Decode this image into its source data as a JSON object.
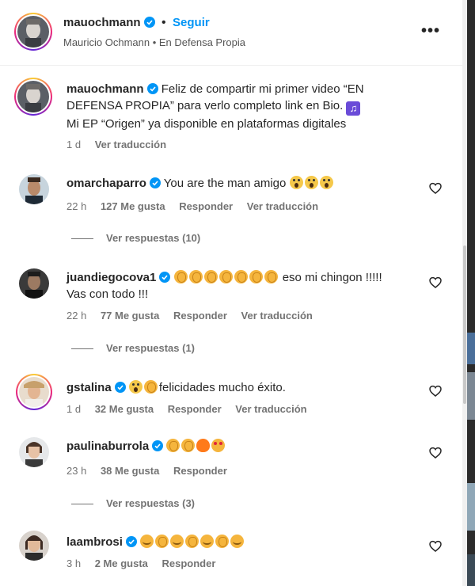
{
  "header": {
    "username": "mauochmann",
    "separator": "•",
    "follow_label": "Seguir",
    "subtitle": "Mauricio Ochmann • En Defensa Propia",
    "more_label": "•••"
  },
  "caption": {
    "username": "mauochmann",
    "text_line1": "Feliz de compartir mi primer video “EN",
    "text_line2": "DEFENSA PROPIA” para verlo completo link en Bio.",
    "text_line3": "Mi EP “Origen” ya disponible en plataformas digitales",
    "time": "1 d",
    "translate": "Ver traducción"
  },
  "comments": [
    {
      "username": "omarchaparro",
      "text": "You are the man amigo",
      "time": "22 h",
      "likes": "127 Me gusta",
      "reply": "Responder",
      "translate": "Ver traducción",
      "replies": "Ver respuestas (10)"
    },
    {
      "username": "juandiegocova1",
      "text": "eso mi chingon !!!!!",
      "text_line2": "Vas con todo !!!",
      "time": "22 h",
      "likes": "77 Me gusta",
      "reply": "Responder",
      "translate": "Ver traducción",
      "replies": "Ver respuestas (1)"
    },
    {
      "username": "gstalina",
      "text": "felicidades mucho éxito.",
      "time": "1 d",
      "likes": "32 Me gusta",
      "reply": "Responder",
      "translate": "Ver traducción"
    },
    {
      "username": "paulinaburrola",
      "time": "23 h",
      "likes": "38 Me gusta",
      "reply": "Responder",
      "replies": "Ver respuestas (3)"
    },
    {
      "username": "laambrosi",
      "time": "3 h",
      "likes": "2 Me gusta",
      "reply": "Responder"
    }
  ],
  "colors": {
    "link": "#0095f6",
    "verified": "#0095f6",
    "muted": "#737373"
  }
}
